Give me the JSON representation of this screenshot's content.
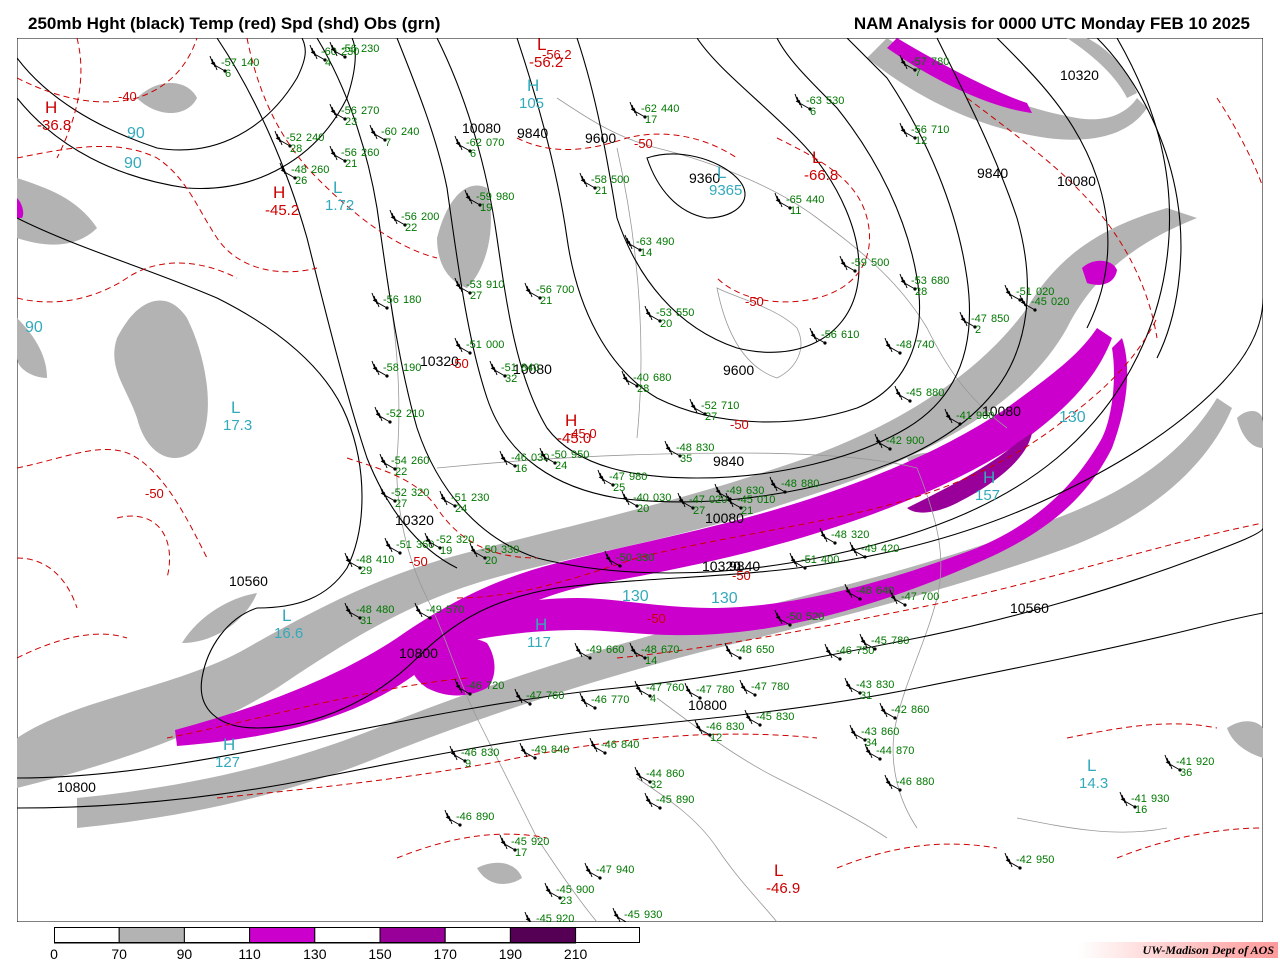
{
  "header": {
    "left_title": "250mb Hght (black) Temp (red) Spd (shd) Obs (grn)",
    "right_title": "NAM Analysis for 0000 UTC Monday  FEB 10 2025"
  },
  "colors": {
    "height_contour": "#000000",
    "temp_contour": "#cc0000",
    "speed_70_90": "#b3b3b3",
    "speed_110_130": "#cc00cc",
    "speed_150_170": "#990099",
    "speed_190_210": "#550055",
    "obs": "#007700",
    "center_label": "#33aabb",
    "geography": "#999999"
  },
  "legend": {
    "labels": [
      "0",
      "70",
      "90",
      "110",
      "130",
      "150",
      "170",
      "190",
      "210"
    ],
    "boxes": [
      {
        "range": "0-70",
        "color": "#ffffff"
      },
      {
        "range": "70-90",
        "color": "#b3b3b3"
      },
      {
        "range": "90-110",
        "color": "#ffffff"
      },
      {
        "range": "110-130",
        "color": "#cc00cc"
      },
      {
        "range": "130-150",
        "color": "#ffffff"
      },
      {
        "range": "150-170",
        "color": "#990099"
      },
      {
        "range": "170-190",
        "color": "#ffffff"
      },
      {
        "range": "190-210",
        "color": "#550055"
      }
    ]
  },
  "credit": "UW-Madison   Dept of AOS",
  "contour_labels": {
    "height": [
      "10080",
      "9840",
      "9600",
      "9360",
      "9840",
      "10080",
      "10320",
      "10080",
      "9600",
      "9840",
      "10080",
      "10320",
      "10320",
      "10560",
      "10560",
      "10800",
      "10800",
      "10800",
      "10320",
      "10080",
      "9840",
      "10080"
    ],
    "temp": [
      "-40",
      "-50",
      "-56.2",
      "-50",
      "-50",
      "-50",
      "-50",
      "-45.0",
      "-50",
      "-50",
      "-50"
    ]
  },
  "centers": [
    {
      "letter": "H",
      "value": "-36.8",
      "kind": "temp"
    },
    {
      "letter": "H",
      "value": "-45.2",
      "kind": "temp"
    },
    {
      "letter": "L",
      "value": "-56.2",
      "kind": "temp"
    },
    {
      "letter": "L",
      "value": "-66.8",
      "kind": "temp"
    },
    {
      "letter": "H",
      "value": "-45.0",
      "kind": "temp"
    },
    {
      "letter": "L",
      "value": "-46.9",
      "kind": "temp"
    },
    {
      "letter": "L",
      "value": "1.72",
      "kind": "speed"
    },
    {
      "letter": "L",
      "value": "17.3",
      "kind": "speed"
    },
    {
      "letter": "L",
      "value": "16.6",
      "kind": "speed"
    },
    {
      "letter": "H",
      "value": "105",
      "kind": "speed"
    },
    {
      "letter": "H",
      "value": "127",
      "kind": "speed"
    },
    {
      "letter": "H",
      "value": "157",
      "kind": "speed"
    },
    {
      "letter": "H",
      "value": "117",
      "kind": "speed"
    },
    {
      "letter": "L",
      "value": "14.3",
      "kind": "speed"
    },
    {
      "letter": "L",
      "value": "9365",
      "kind": "height"
    }
  ],
  "speed_labels": [
    "90",
    "90",
    "90",
    "130",
    "130",
    "130"
  ],
  "stations": [
    {
      "temp": "-57",
      "dew": "6",
      "hgt": "140"
    },
    {
      "temp": "-60",
      "dew": "4",
      "hgt": "230"
    },
    {
      "temp": "-56",
      "dew": "",
      "hgt": "230"
    },
    {
      "temp": "-56",
      "dew": "23",
      "hgt": "270"
    },
    {
      "temp": "-52",
      "dew": "28",
      "hgt": "240"
    },
    {
      "temp": "-60",
      "dew": "7",
      "hgt": "240"
    },
    {
      "temp": "-56",
      "dew": "21",
      "hgt": "260"
    },
    {
      "temp": "-48",
      "dew": "26",
      "hgt": "260"
    },
    {
      "temp": "-62",
      "dew": "6",
      "hgt": "070"
    },
    {
      "temp": "-59",
      "dew": "19",
      "hgt": "980"
    },
    {
      "temp": "-56",
      "dew": "22",
      "hgt": "200"
    },
    {
      "temp": "-58",
      "dew": "21",
      "hgt": "500"
    },
    {
      "temp": "-63",
      "dew": "14",
      "hgt": "490"
    },
    {
      "temp": "-62",
      "dew": "17",
      "hgt": "440"
    },
    {
      "temp": "-63",
      "dew": "6",
      "hgt": "530"
    },
    {
      "temp": "-65",
      "dew": "11",
      "hgt": "440"
    },
    {
      "temp": "-57",
      "dew": "7",
      "hgt": "780"
    },
    {
      "temp": "-56",
      "dew": "12",
      "hgt": "710"
    },
    {
      "temp": "-59",
      "dew": "",
      "hgt": "500"
    },
    {
      "temp": "-53",
      "dew": "28",
      "hgt": "680"
    },
    {
      "temp": "-51",
      "dew": "",
      "hgt": "020"
    },
    {
      "temp": "-47",
      "dew": "2",
      "hgt": "850"
    },
    {
      "temp": "-56",
      "dew": "",
      "hgt": "610"
    },
    {
      "temp": "-48",
      "dew": "",
      "hgt": "740"
    },
    {
      "temp": "-45",
      "dew": "",
      "hgt": "880"
    },
    {
      "temp": "-53",
      "dew": "27",
      "hgt": "910"
    },
    {
      "temp": "-56",
      "dew": "21",
      "hgt": "700"
    },
    {
      "temp": "-56",
      "dew": "",
      "hgt": "180"
    },
    {
      "temp": "-53",
      "dew": "20",
      "hgt": "550"
    },
    {
      "temp": "-51",
      "dew": "",
      "hgt": "000"
    },
    {
      "temp": "-58",
      "dew": "",
      "hgt": "190"
    },
    {
      "temp": "-51",
      "dew": "32",
      "hgt": "840"
    },
    {
      "temp": "-40",
      "dew": "28",
      "hgt": "680"
    },
    {
      "temp": "-52",
      "dew": "27",
      "hgt": "710"
    },
    {
      "temp": "-52",
      "dew": "",
      "hgt": "210"
    },
    {
      "temp": "-54",
      "dew": "22",
      "hgt": "260"
    },
    {
      "temp": "-48",
      "dew": "35",
      "hgt": "830"
    },
    {
      "temp": "-41",
      "dew": "",
      "hgt": "900"
    },
    {
      "temp": "-42",
      "dew": "",
      "hgt": "900"
    },
    {
      "temp": "-52",
      "dew": "27",
      "hgt": "320"
    },
    {
      "temp": "-51",
      "dew": "24",
      "hgt": "230"
    },
    {
      "temp": "-46",
      "dew": "16",
      "hgt": "030"
    },
    {
      "temp": "-50",
      "dew": "24",
      "hgt": "950"
    },
    {
      "temp": "-47",
      "dew": "25",
      "hgt": "980"
    },
    {
      "temp": "-40",
      "dew": "20",
      "hgt": "030"
    },
    {
      "temp": "-47",
      "dew": "27",
      "hgt": "020"
    },
    {
      "temp": "-45",
      "dew": "21",
      "hgt": "010"
    },
    {
      "temp": "-48",
      "dew": "",
      "hgt": "880"
    },
    {
      "temp": "-48",
      "dew": "",
      "hgt": "320"
    },
    {
      "temp": "-51",
      "dew": "",
      "hgt": "360"
    },
    {
      "temp": "-52",
      "dew": "19",
      "hgt": "320"
    },
    {
      "temp": "-50",
      "dew": "20",
      "hgt": "330"
    },
    {
      "temp": "-48",
      "dew": "29",
      "hgt": "410"
    },
    {
      "temp": "-48",
      "dew": "31",
      "hgt": "480"
    },
    {
      "temp": "-49",
      "dew": "",
      "hgt": "570"
    },
    {
      "temp": "-50",
      "dew": "",
      "hgt": "330"
    },
    {
      "temp": "-51",
      "dew": "",
      "hgt": "400"
    },
    {
      "temp": "-50",
      "dew": "",
      "hgt": "520"
    },
    {
      "temp": "-49",
      "dew": "",
      "hgt": "660"
    },
    {
      "temp": "-48",
      "dew": "14",
      "hgt": "670"
    },
    {
      "temp": "-48",
      "dew": "",
      "hgt": "650"
    },
    {
      "temp": "-48",
      "dew": "",
      "hgt": "640"
    },
    {
      "temp": "-47",
      "dew": "",
      "hgt": "700"
    },
    {
      "temp": "-46",
      "dew": "",
      "hgt": "750"
    },
    {
      "temp": "-45",
      "dew": "",
      "hgt": "780"
    },
    {
      "temp": "-46",
      "dew": "",
      "hgt": "720"
    },
    {
      "temp": "-47",
      "dew": "",
      "hgt": "760"
    },
    {
      "temp": "-46",
      "dew": "",
      "hgt": "770"
    },
    {
      "temp": "-47",
      "dew": "4",
      "hgt": "760"
    },
    {
      "temp": "-47",
      "dew": "",
      "hgt": "780"
    },
    {
      "temp": "-47",
      "dew": "",
      "hgt": "780"
    },
    {
      "temp": "-43",
      "dew": "31",
      "hgt": "830"
    },
    {
      "temp": "-45",
      "dew": "",
      "hgt": "830"
    },
    {
      "temp": "-46",
      "dew": "12",
      "hgt": "830"
    },
    {
      "temp": "-42",
      "dew": "",
      "hgt": "860"
    },
    {
      "temp": "-43",
      "dew": "34",
      "hgt": "860"
    },
    {
      "temp": "-44",
      "dew": "",
      "hgt": "870"
    },
    {
      "temp": "-46",
      "dew": "",
      "hgt": "880"
    },
    {
      "temp": "-44",
      "dew": "32",
      "hgt": "860"
    },
    {
      "temp": "-45",
      "dew": "",
      "hgt": "890"
    },
    {
      "temp": "-46",
      "dew": "",
      "hgt": "840"
    },
    {
      "temp": "-49",
      "dew": "",
      "hgt": "840"
    },
    {
      "temp": "-46",
      "dew": "9",
      "hgt": "830"
    },
    {
      "temp": "-46",
      "dew": "",
      "hgt": "890"
    },
    {
      "temp": "-45",
      "dew": "17",
      "hgt": "920"
    },
    {
      "temp": "-45",
      "dew": "23",
      "hgt": "900"
    },
    {
      "temp": "-45",
      "dew": "",
      "hgt": "920"
    },
    {
      "temp": "-45",
      "dew": "",
      "hgt": "930"
    },
    {
      "temp": "-47",
      "dew": "",
      "hgt": "940"
    },
    {
      "temp": "-42",
      "dew": "",
      "hgt": "950"
    },
    {
      "temp": "-41",
      "dew": "36",
      "hgt": "920"
    },
    {
      "temp": "-41",
      "dew": "16",
      "hgt": "930"
    },
    {
      "temp": "-49",
      "dew": "",
      "hgt": "420"
    },
    {
      "temp": "-49",
      "dew": "",
      "hgt": "630"
    },
    {
      "temp": "-45",
      "dew": "",
      "hgt": "020"
    }
  ]
}
